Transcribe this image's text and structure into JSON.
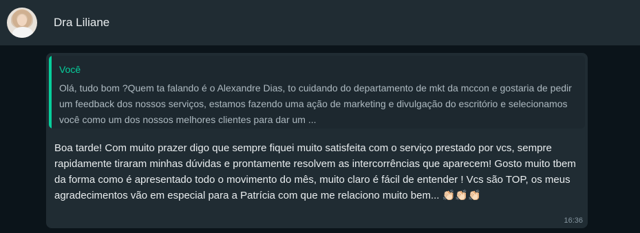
{
  "header": {
    "contact_name": "Dra Liliane"
  },
  "message": {
    "quote": {
      "author": "Você",
      "text": "Olá, tudo bom ?Quem ta falando é o Alexandre Dias, to cuidando do departamento de mkt da mccon e gostaria de pedir um feedback dos nossos serviços, estamos fazendo uma ação de marketing e divulgação do escritório e selecionamos você como um dos nossos melhores clientes para dar um ..."
    },
    "body": "Boa tarde! Com muito prazer digo que sempre fiquei muito satisfeita com o serviço prestado por vcs, sempre rapidamente tiraram minhas dúvidas e prontamente resolvem as intercorrências que aparecem! Gosto muito tbem da forma como é apresentado todo o movimento do mês, muito claro é fácil de entender ! Vcs são TOP, os meus agradecimentos vão em especial para a Patrícia com que me relaciono muito bem...",
    "emoji": "👏🏻👏🏻👏🏻",
    "time": "16:36"
  },
  "colors": {
    "header_bg": "#202c33",
    "chat_bg": "#0b141a",
    "bubble_bg": "#202c33",
    "quote_accent": "#06cf9c",
    "text_primary": "#e9edef",
    "text_secondary": "#8696a0"
  }
}
